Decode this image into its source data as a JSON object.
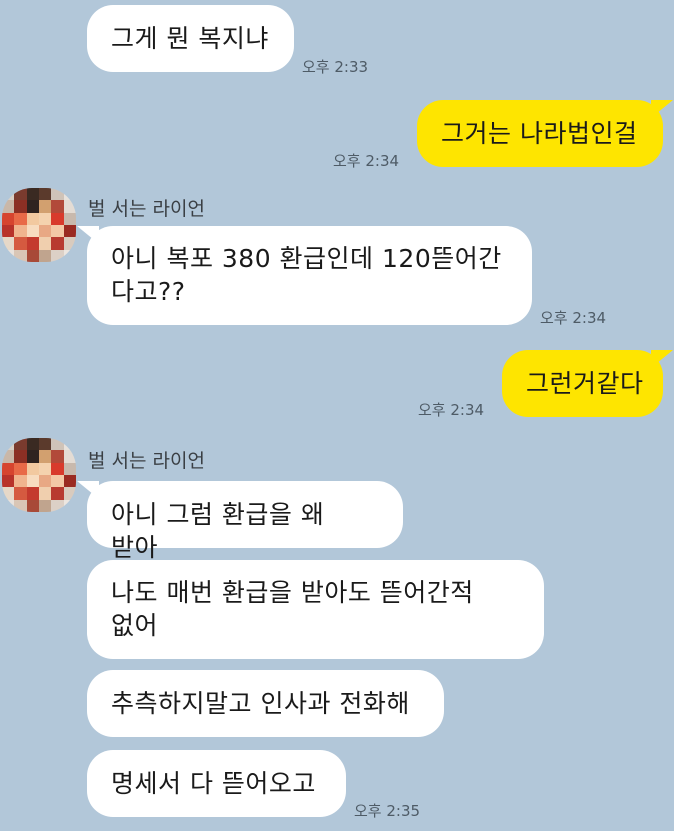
{
  "colors": {
    "background": "#b2c7d9",
    "incoming_bubble": "#ffffff",
    "outgoing_bubble": "#fee500"
  },
  "messages": [
    {
      "direction": "in",
      "text": "그게 뭔 복지냐",
      "time": "오후 2:33"
    },
    {
      "direction": "out",
      "text": "그거는 나라법인걸",
      "time": "오후 2:34"
    },
    {
      "direction": "in",
      "sender": "벌 서는 라이언",
      "text": "아니 복포 380 환급인데 120뜯어간 다고??",
      "time": "오후 2:34"
    },
    {
      "direction": "out",
      "text": "그런거같다",
      "time": "오후 2:34"
    },
    {
      "direction": "in",
      "sender": "벌 서는 라이언",
      "text": "아니 그럼 환급을 왜 받아"
    },
    {
      "direction": "in",
      "text": "나도 매번 환급을 받아도 뜯어간적 없어"
    },
    {
      "direction": "in",
      "text": "추측하지말고 인사과 전화해"
    },
    {
      "direction": "in",
      "text": "명세서 다 뜯어오고",
      "time": "오후 2:35"
    }
  ],
  "avatar_icon": "pixelated-profile-icon"
}
